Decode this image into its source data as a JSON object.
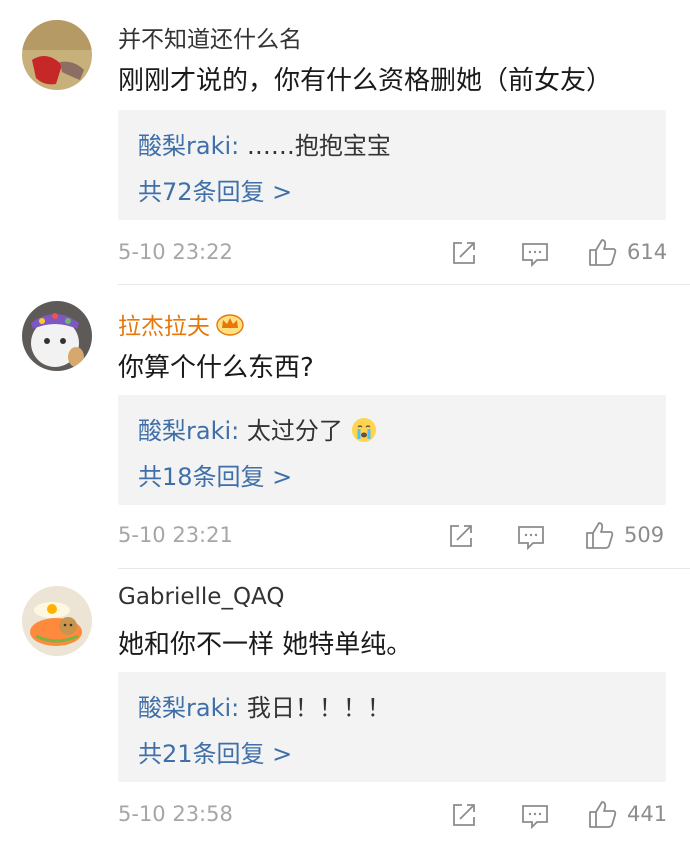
{
  "comments": [
    {
      "username": "并不知道还什么名",
      "text": "刚刚才说的，你有什么资格删她（前女友）",
      "reply_user": "酸梨raki:",
      "reply_text": "……抱抱宝宝",
      "reply_count": "共72条回复 >",
      "time": "5-10 23:22",
      "likes": "614"
    },
    {
      "username": "拉杰拉夫",
      "text": "你算个什么东西?",
      "reply_user": "酸梨raki:",
      "reply_text": "太过分了",
      "reply_count": "共18条回复 >",
      "time": "5-10 23:21",
      "likes": "509"
    },
    {
      "username": "Gabrielle_QAQ",
      "text": "她和你不一样 她特单纯。",
      "reply_user": "酸梨raki:",
      "reply_text": "我日！！！！",
      "reply_count": "共21条回复 >",
      "time": "5-10 23:58",
      "likes": "441"
    }
  ],
  "colors": {
    "link_blue": "#3f6fa8",
    "vip_orange": "#e6780a",
    "meta_gray": "#a6a6a6",
    "reply_bg": "#f3f3f3"
  },
  "icons": [
    "share-icon",
    "comment-icon",
    "like-icon",
    "crown-badge-icon",
    "crying-emoji-icon"
  ]
}
